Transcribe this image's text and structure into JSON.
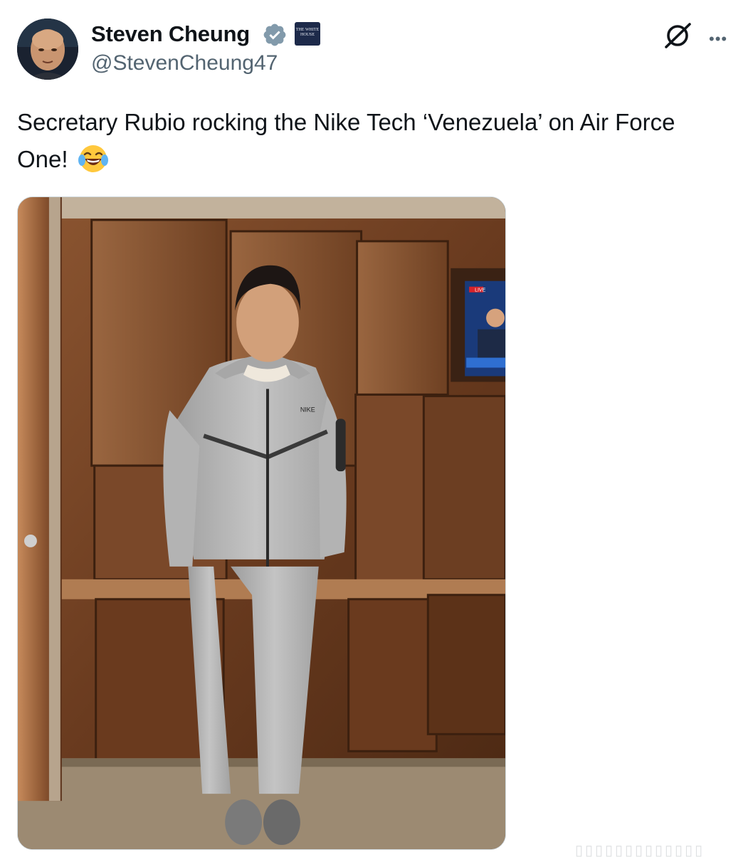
{
  "author": {
    "name": "Steven Cheung",
    "handle": "@StevenCheung47",
    "affiliation_badge": "THE WHITE HOUSE"
  },
  "post": {
    "text": "Secretary Rubio rocking the Nike Tech ‘Venezuela’ on Air Force One!",
    "emoji": "face-with-tears-of-joy"
  },
  "media": {
    "photo_label": "Man in grey Nike Tech tracksuit standing against wood paneling aboard aircraft",
    "tv_live_label": "LIVE",
    "jacket_logo": "NIKE"
  },
  "icons": {
    "verified": "verified-badge-icon",
    "grok": "grok-icon",
    "more": "more-options-icon"
  },
  "colors": {
    "text_primary": "#0f1419",
    "text_secondary": "#536471",
    "verified_badge": "#829aab",
    "border": "#cfd9de"
  }
}
